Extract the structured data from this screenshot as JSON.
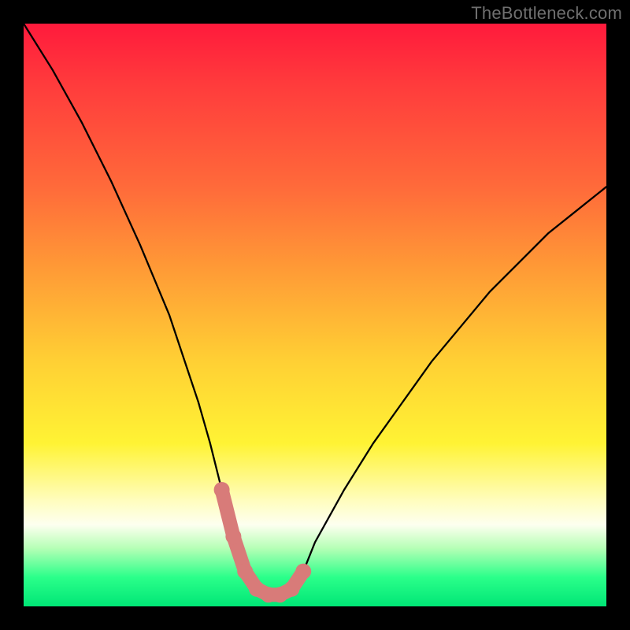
{
  "watermark": "TheBottleneck.com",
  "chart_data": {
    "type": "line",
    "title": "",
    "xlabel": "",
    "ylabel": "",
    "xlim": [
      0,
      100
    ],
    "ylim": [
      0,
      100
    ],
    "series": [
      {
        "name": "bottleneck-curve",
        "x": [
          0,
          5,
          10,
          15,
          20,
          25,
          28,
          30,
          32,
          34,
          36,
          38,
          40,
          42,
          44,
          46,
          48,
          50,
          55,
          60,
          65,
          70,
          75,
          80,
          85,
          90,
          95,
          100
        ],
        "values": [
          100,
          92,
          83,
          73,
          62,
          50,
          41,
          35,
          28,
          20,
          12,
          6,
          3,
          2,
          2,
          3,
          6,
          11,
          20,
          28,
          35,
          42,
          48,
          54,
          59,
          64,
          68,
          72
        ]
      }
    ],
    "highlight": {
      "name": "optimal-zone",
      "color": "#d87b79",
      "x": [
        34,
        36,
        38,
        40,
        42,
        44,
        46,
        48
      ],
      "values": [
        20,
        12,
        6,
        3,
        2,
        2,
        3,
        6
      ]
    },
    "gradient_stops": [
      {
        "pos": 0,
        "color": "#ff1a3c"
      },
      {
        "pos": 28,
        "color": "#ff6a3a"
      },
      {
        "pos": 58,
        "color": "#ffd034"
      },
      {
        "pos": 82,
        "color": "#fffdc0"
      },
      {
        "pos": 95,
        "color": "#2bff8a"
      },
      {
        "pos": 100,
        "color": "#00e676"
      }
    ]
  }
}
